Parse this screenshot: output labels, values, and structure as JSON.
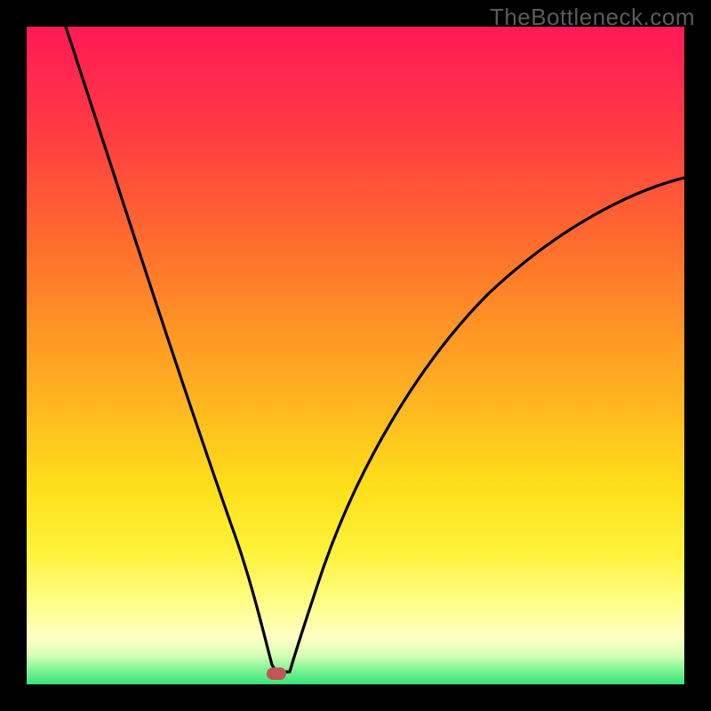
{
  "watermark": "TheBottleneck.com",
  "chart_data": {
    "type": "line",
    "title": "",
    "xlabel": "",
    "ylabel": "",
    "xlim": [
      0,
      100
    ],
    "ylim": [
      0,
      100
    ],
    "grid": false,
    "legend": false,
    "annotations": [],
    "marker": {
      "x": 38,
      "y": 1.5,
      "color": "#c25555"
    },
    "series": [
      {
        "name": "bottleneck-curve",
        "color": "#000000",
        "x": [
          6,
          10,
          14,
          18,
          22,
          26,
          30,
          33,
          35,
          36.5,
          38,
          39.5,
          41,
          44,
          48,
          54,
          60,
          68,
          78,
          88,
          98
        ],
        "y": [
          100,
          84,
          70,
          57,
          45,
          34,
          24,
          15,
          9,
          4,
          1.5,
          2,
          3,
          8,
          17,
          30,
          41,
          52,
          62,
          68,
          73
        ]
      },
      {
        "name": "bottleneck-curve-flat-bottom",
        "color": "#000000",
        "x": [
          35,
          36,
          37,
          38,
          39,
          40
        ],
        "y": [
          2.2,
          1.8,
          1.6,
          1.5,
          1.6,
          1.9
        ]
      }
    ],
    "background_gradient_stops": [
      {
        "pos": 0,
        "color": "#ff1a56"
      },
      {
        "pos": 0.32,
        "color": "#ff6a2f"
      },
      {
        "pos": 0.58,
        "color": "#ffb81f"
      },
      {
        "pos": 0.8,
        "color": "#fff23a"
      },
      {
        "pos": 0.93,
        "color": "#fdffc5"
      },
      {
        "pos": 1.0,
        "color": "#36e47a"
      }
    ]
  }
}
